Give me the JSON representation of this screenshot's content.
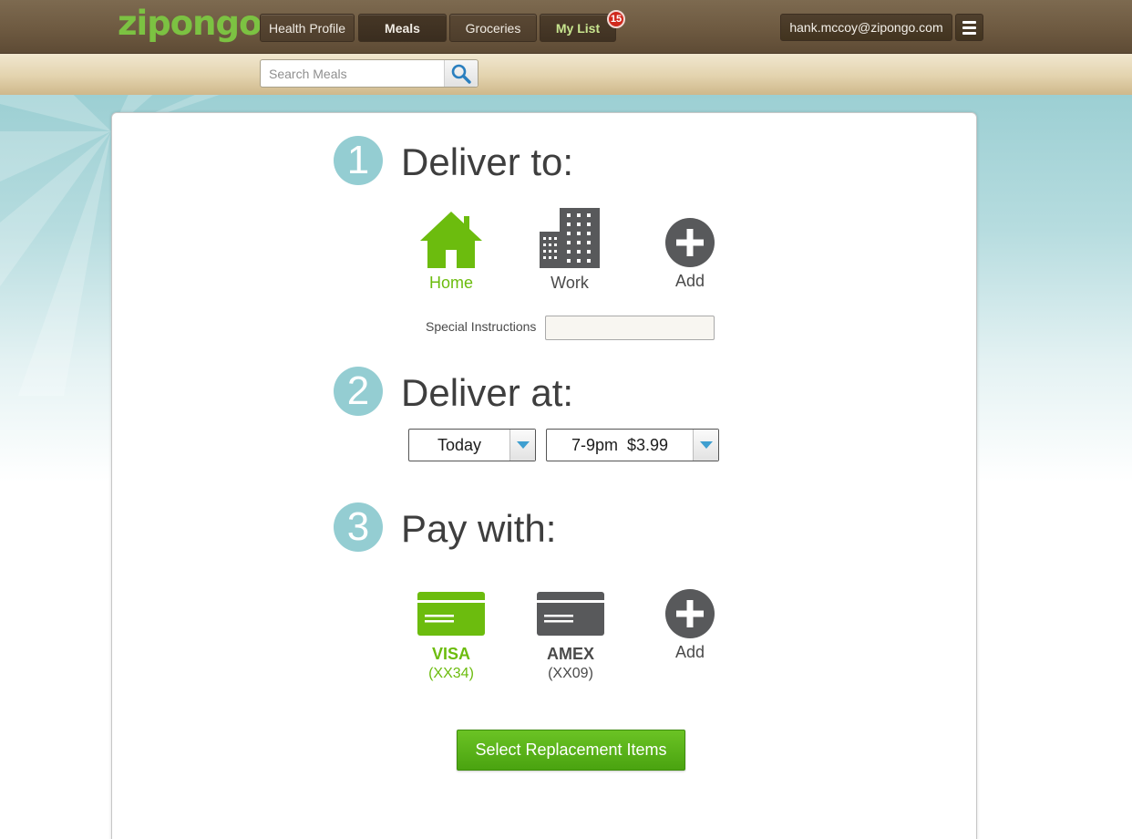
{
  "header": {
    "logo": "zipongo",
    "nav": [
      {
        "label": "Health Profile"
      },
      {
        "label": "Meals"
      },
      {
        "label": "Groceries"
      },
      {
        "label": "My List"
      }
    ],
    "list_badge": "15",
    "user_email": "hank.mccoy@zipongo.com"
  },
  "search": {
    "placeholder": "Search Meals",
    "value": ""
  },
  "steps": {
    "deliver_to": {
      "number": "1",
      "title": "Deliver to:",
      "options": [
        {
          "label": "Home",
          "selected": true
        },
        {
          "label": "Work",
          "selected": false
        },
        {
          "label": "Add",
          "selected": false
        }
      ],
      "special_instructions_label": "Special Instructions",
      "special_instructions_value": ""
    },
    "deliver_at": {
      "number": "2",
      "title": "Deliver at:",
      "day": "Today",
      "window": "7-9pm  $3.99"
    },
    "pay_with": {
      "number": "3",
      "title": "Pay with:",
      "options": [
        {
          "label": "VISA",
          "detail": "(XX34)",
          "selected": true
        },
        {
          "label": "AMEX",
          "detail": "(XX09)",
          "selected": false
        },
        {
          "label": "Add",
          "selected": false
        }
      ]
    }
  },
  "primary_button": "Select Replacement Items",
  "colors": {
    "accent_green": "#6cbc0e",
    "step_teal": "#94cdd2",
    "icon_gray": "#58595b",
    "header_brown": "#6e5a41"
  },
  "icons": [
    "search-icon",
    "menu-icon",
    "home-icon",
    "building-icon",
    "add-icon",
    "credit-card-icon"
  ]
}
